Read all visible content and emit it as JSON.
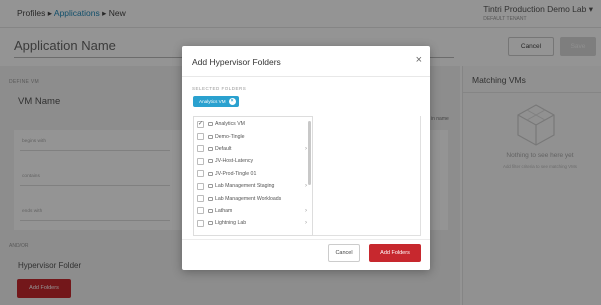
{
  "header": {
    "breadcrumb": [
      "Profiles",
      "Applications",
      "New"
    ],
    "separator": "▸",
    "environment": "Tintri Production Demo Lab ▾",
    "environment_sub": "DEFAULT TENANT"
  },
  "application_name": {
    "placeholder": "Application Name"
  },
  "top_buttons": {
    "cancel": "Cancel",
    "save": "Save"
  },
  "left_panel": {
    "section1_label": "DEFINE VM",
    "vm_name_title": "VM Name",
    "fields": [
      "begins with",
      "contains",
      "ends with"
    ],
    "side_text": "in name",
    "section2_label": "AND/OR",
    "hypervisor_title": "Hypervisor Folder",
    "add_folders_button": "Add Folders"
  },
  "right_panel": {
    "title": "Matching VMs",
    "empty_title": "Nothing to see here yet",
    "empty_sub": "Add filter criteria to see matching VMs"
  },
  "modal": {
    "title": "Add Hypervisor Folders",
    "close": "×",
    "selected_label": "SELECTED FOLDERS",
    "selected": [
      "Analytics VM"
    ],
    "folders": [
      {
        "name": "Analytics VM",
        "checked": true,
        "has_children": false
      },
      {
        "name": "Demo-Tingle",
        "checked": false,
        "has_children": false
      },
      {
        "name": "Default",
        "checked": false,
        "has_children": true
      },
      {
        "name": "JV-Host-Latency",
        "checked": false,
        "has_children": false
      },
      {
        "name": "JV-Prod-Tingle 01",
        "checked": false,
        "has_children": false
      },
      {
        "name": "Lab Management Staging",
        "checked": false,
        "has_children": true
      },
      {
        "name": "Lab Management Workloads",
        "checked": false,
        "has_children": false
      },
      {
        "name": "Latham",
        "checked": false,
        "has_children": true
      },
      {
        "name": "Lightning Lab",
        "checked": false,
        "has_children": true
      }
    ],
    "cancel": "Cancel",
    "add": "Add Folders"
  },
  "colors": {
    "primary_red": "#c7282e",
    "chip_blue": "#2aa1cf",
    "link_blue": "#1f88b8"
  }
}
